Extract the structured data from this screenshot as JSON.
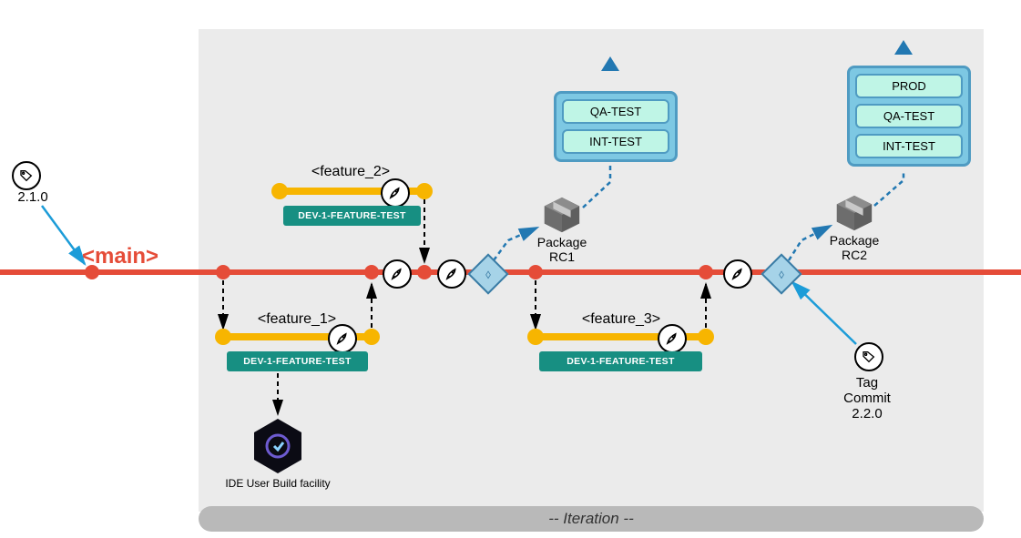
{
  "main_label": "<main>",
  "tag_start": "2.1.0",
  "features": {
    "f1": {
      "label": "<feature_1>",
      "test_label": "DEV-1-FEATURE-TEST"
    },
    "f2": {
      "label": "<feature_2>",
      "test_label": "DEV-1-FEATURE-TEST"
    },
    "f3": {
      "label": "<feature_3>",
      "test_label": "DEV-1-FEATURE-TEST"
    }
  },
  "packages": {
    "rc1": "Package\nRC1",
    "rc2": "Package\nRC2"
  },
  "env": {
    "stack1": [
      "QA-TEST",
      "INT-TEST"
    ],
    "stack2": [
      "PROD",
      "QA-TEST",
      "INT-TEST"
    ]
  },
  "tag_end": "Tag\nCommit\n2.2.0",
  "iteration_label": "-- Iteration --",
  "ide_label": "IDE User Build facility",
  "colors": {
    "main": "#E54C38",
    "feature": "#F7B500",
    "teal": "#178f82",
    "env_border": "#4f9bc2",
    "env_fill": "#7dc8e3",
    "chip": "#bff5e6",
    "iter_box": "#ebebeb"
  }
}
